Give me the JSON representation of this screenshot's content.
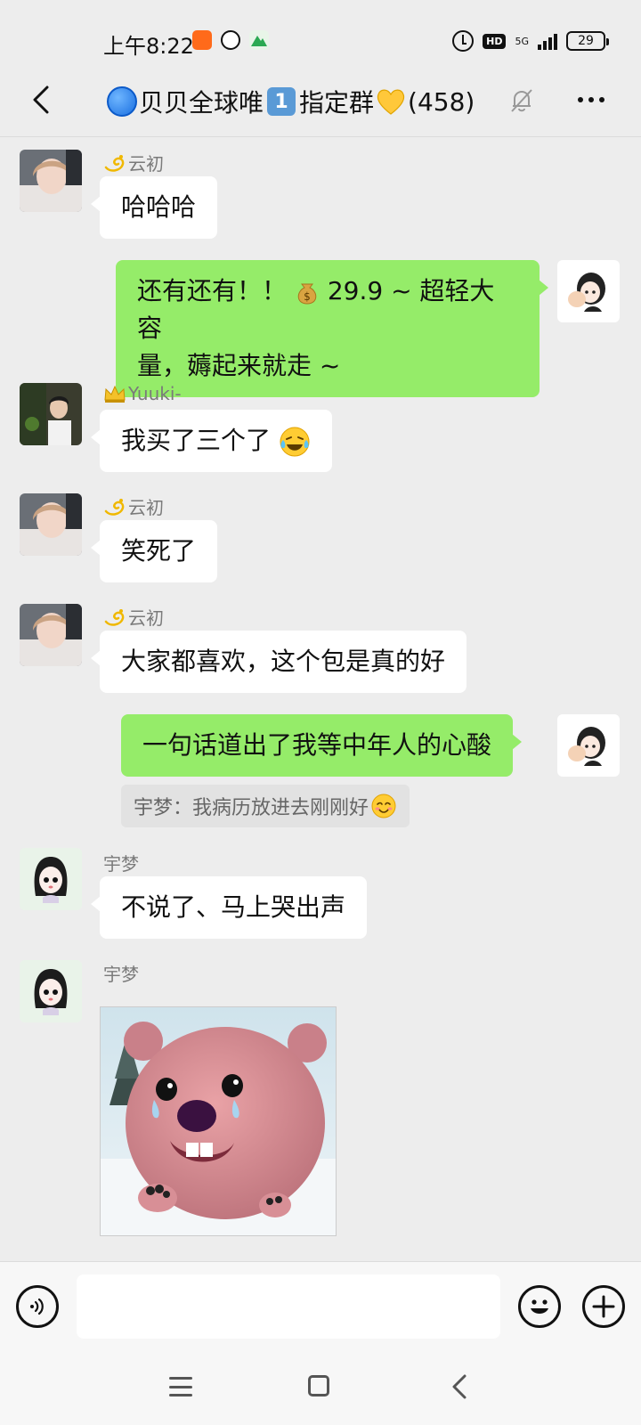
{
  "status_bar": {
    "time": "上午8:22",
    "network": "5G",
    "hd": "HD",
    "battery": "29"
  },
  "header": {
    "title_part1": "贝贝全球唯",
    "title_keycap": "1",
    "title_part2": "指定群",
    "member_count": "(458)",
    "muted": true
  },
  "messages": [
    {
      "side": "left",
      "sender": "云初",
      "sender_badge": "dizzy-icon",
      "text": "哈哈哈"
    },
    {
      "side": "right",
      "text_line1": "还有还有！！",
      "text_price": "29.9 ~ 超轻大容",
      "text_line2": "量，薅起来就走 ~",
      "emoji": "money-bag-icon"
    },
    {
      "side": "left",
      "sender": "Yuuki-",
      "sender_badge": "crown-icon",
      "text": "我买了三个了",
      "emoji": "crying-laughing-icon"
    },
    {
      "side": "left",
      "sender": "云初",
      "sender_badge": "dizzy-icon",
      "text": "笑死了"
    },
    {
      "side": "left",
      "sender": "云初",
      "sender_badge": "dizzy-icon",
      "text": "大家都喜欢，这个包是真的好"
    },
    {
      "side": "right",
      "text": "一句话道出了我等中年人的心酸",
      "quote": "宇梦：我病历放进去刚刚好",
      "quote_emoji": "smiling-blush-icon"
    },
    {
      "side": "left",
      "sender": "宇梦",
      "text": "不说了、马上哭出声"
    },
    {
      "side": "left",
      "sender": "宇梦",
      "sticker": "crying-pink-beaver-sticker"
    }
  ],
  "colors": {
    "background": "#ededed",
    "bubble_self": "#95ec69",
    "bubble_other": "#ffffff"
  }
}
